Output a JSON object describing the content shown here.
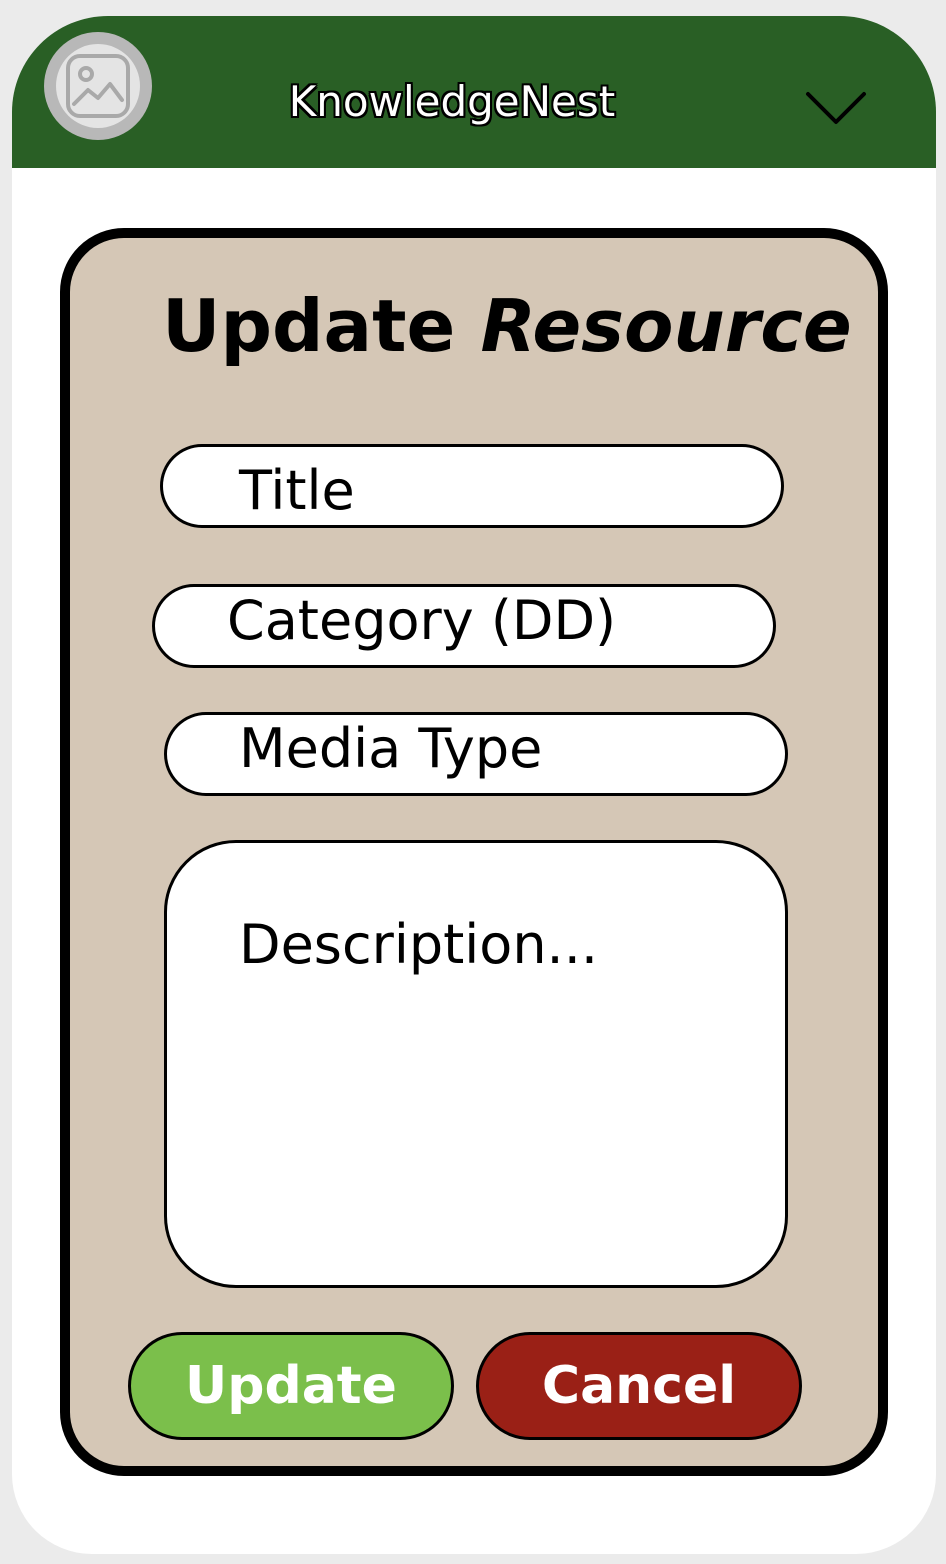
{
  "header": {
    "app_name": "KnowledgeNest",
    "logo_icon": "image-placeholder-icon",
    "menu_icon": "chevron-down-icon",
    "background_color": "#295f25"
  },
  "form": {
    "title_plain": "Update",
    "title_emphasis": "Resource",
    "background_color": "#d5c7b6",
    "fields": {
      "title_placeholder": "Title",
      "category_placeholder": "Category (DD)",
      "media_type_placeholder": "Media Type",
      "description_placeholder": "Description..."
    },
    "actions": {
      "update_label": "Update",
      "update_color": "#7bbf4b",
      "cancel_label": "Cancel",
      "cancel_color": "#9a2016"
    }
  }
}
